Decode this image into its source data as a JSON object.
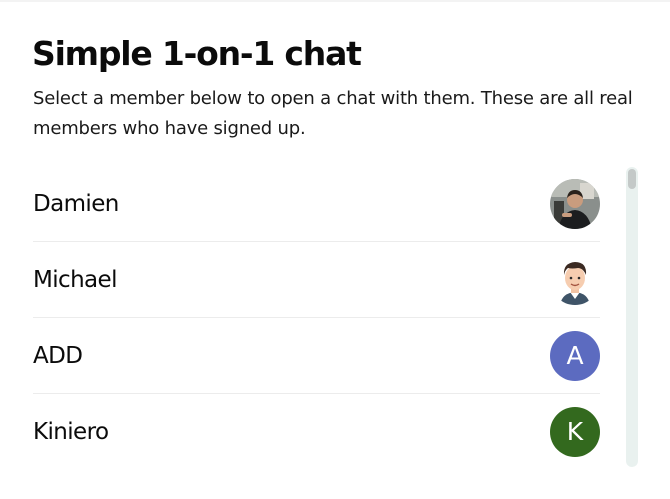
{
  "header": {
    "title": "Simple 1-on-1 chat",
    "subtitle": "Select a member below to open a chat with them. These are all real members who have signed up."
  },
  "members": [
    {
      "name": "Damien",
      "avatar": "photo"
    },
    {
      "name": "Michael",
      "avatar": "cartoon"
    },
    {
      "name": "ADD",
      "avatar_letter": "A",
      "avatar_color": "#5c6bc0"
    },
    {
      "name": "Kiniero",
      "avatar_letter": "K",
      "avatar_color": "#33691e"
    }
  ],
  "colors": {
    "scrollbar_track": "#e9f1ef",
    "scrollbar_thumb": "#c4c9c8"
  }
}
